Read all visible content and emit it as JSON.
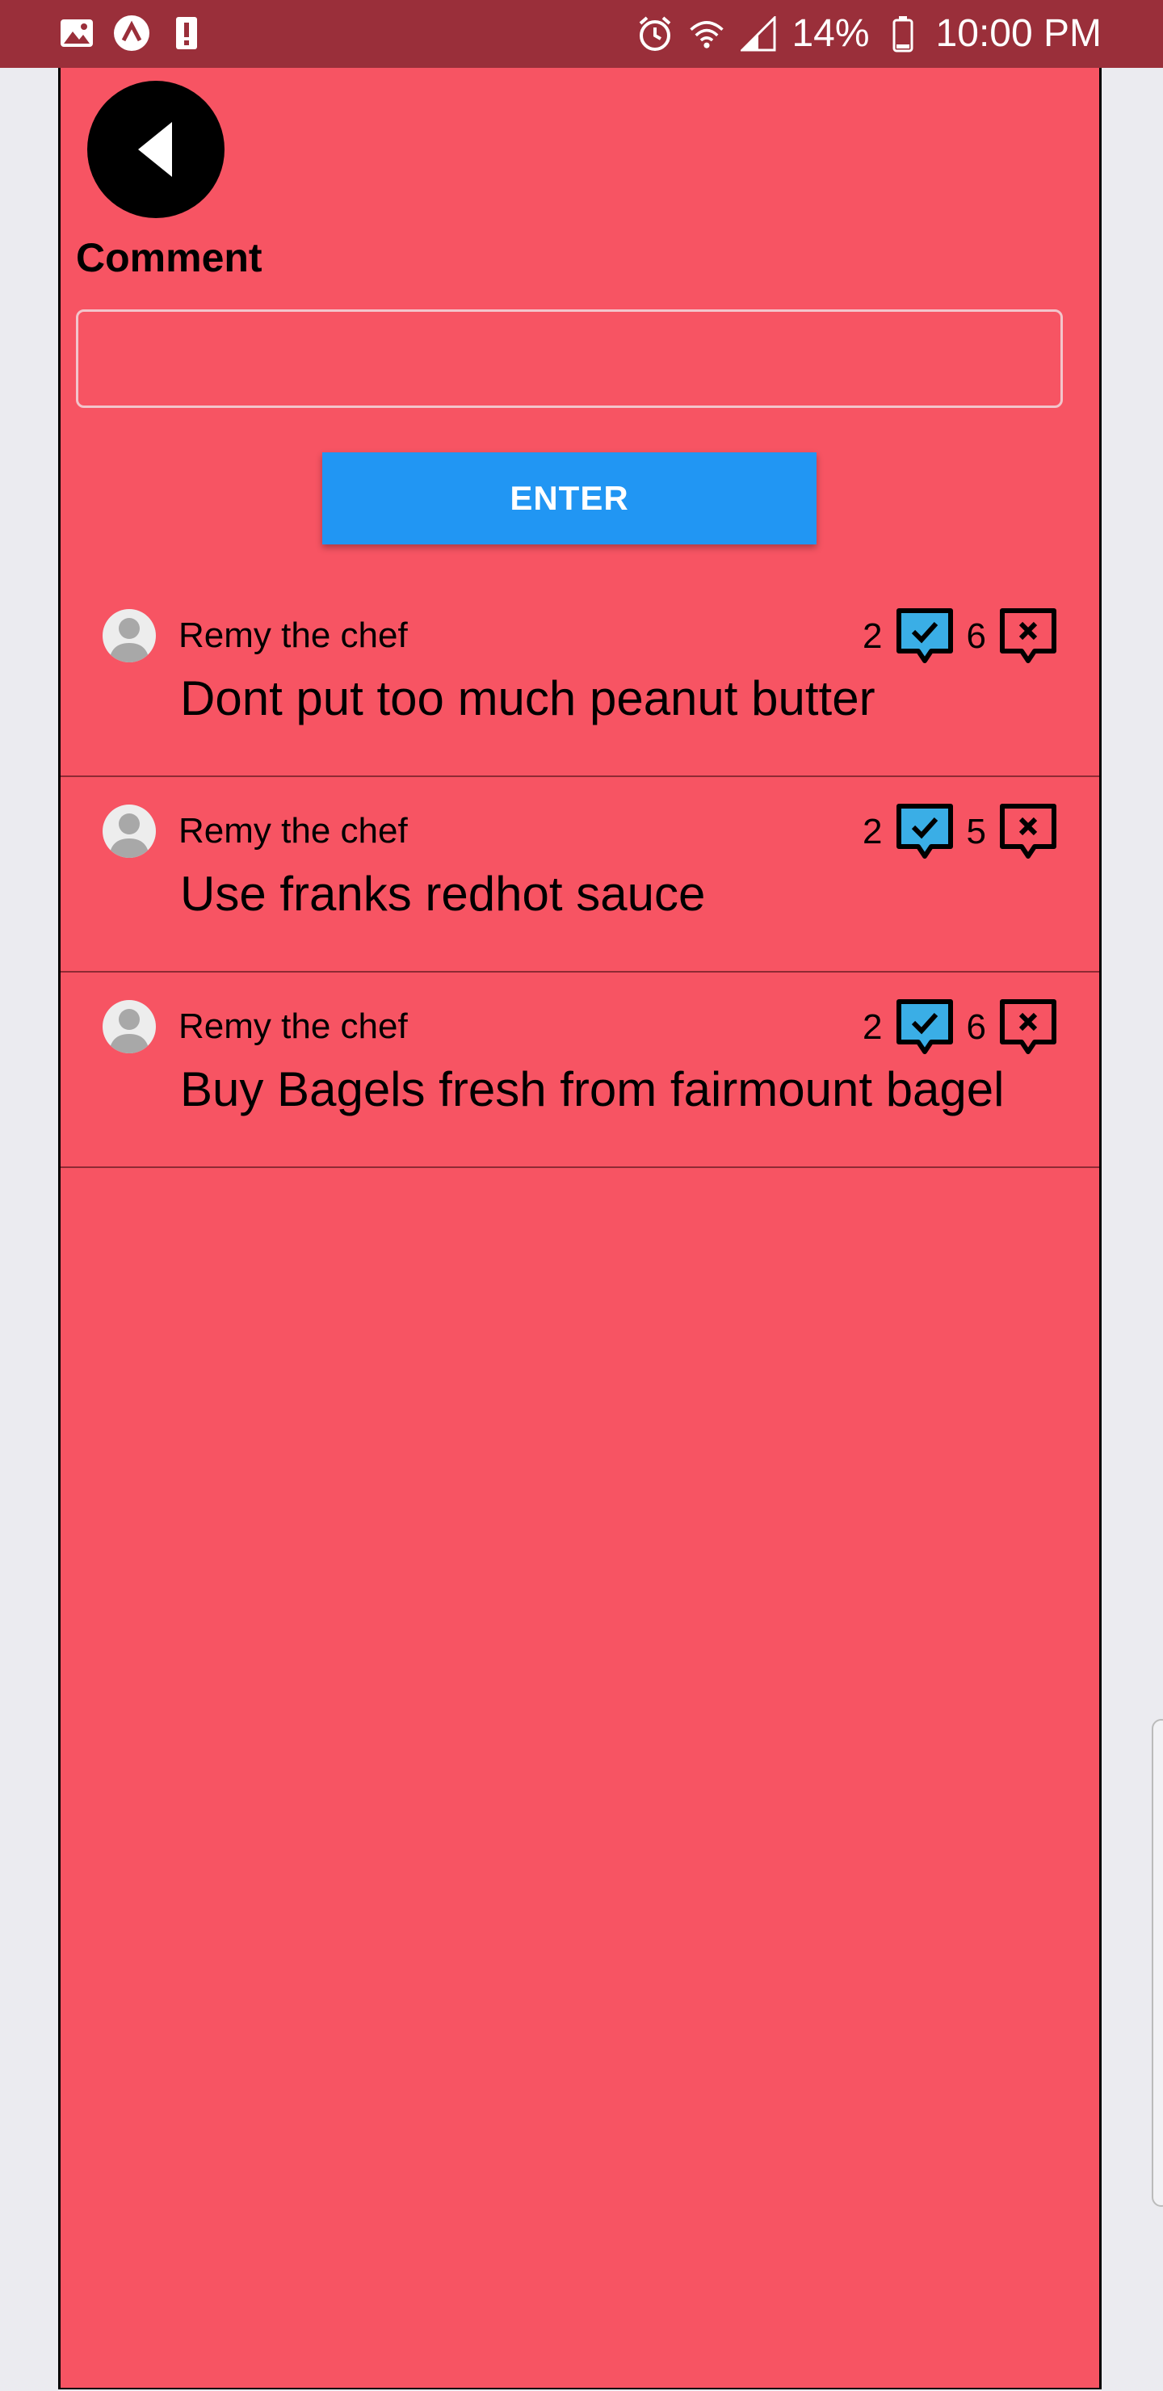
{
  "status_bar": {
    "battery_percent": "14%",
    "time": "10:00 PM",
    "icons": [
      "image-icon",
      "app-icon",
      "alert-icon",
      "alarm-icon",
      "wifi-icon",
      "signal-icon",
      "battery-icon"
    ]
  },
  "colors": {
    "background": "#F75463",
    "status_bar": "#9A2F3A",
    "button": "#2196F3",
    "upvote": "#3AAEE6"
  },
  "form": {
    "label": "Comment",
    "input_value": "",
    "input_placeholder": "",
    "enter_label": "ENTER"
  },
  "comments": [
    {
      "author": "Remy the chef",
      "text": "Dont put too much peanut butter",
      "upvotes": "2",
      "downvotes": "6"
    },
    {
      "author": "Remy the chef",
      "text": "Use franks redhot sauce",
      "upvotes": "2",
      "downvotes": "5"
    },
    {
      "author": "Remy the chef",
      "text": "Buy Bagels fresh from fairmount bagel",
      "upvotes": "2",
      "downvotes": "6"
    }
  ]
}
